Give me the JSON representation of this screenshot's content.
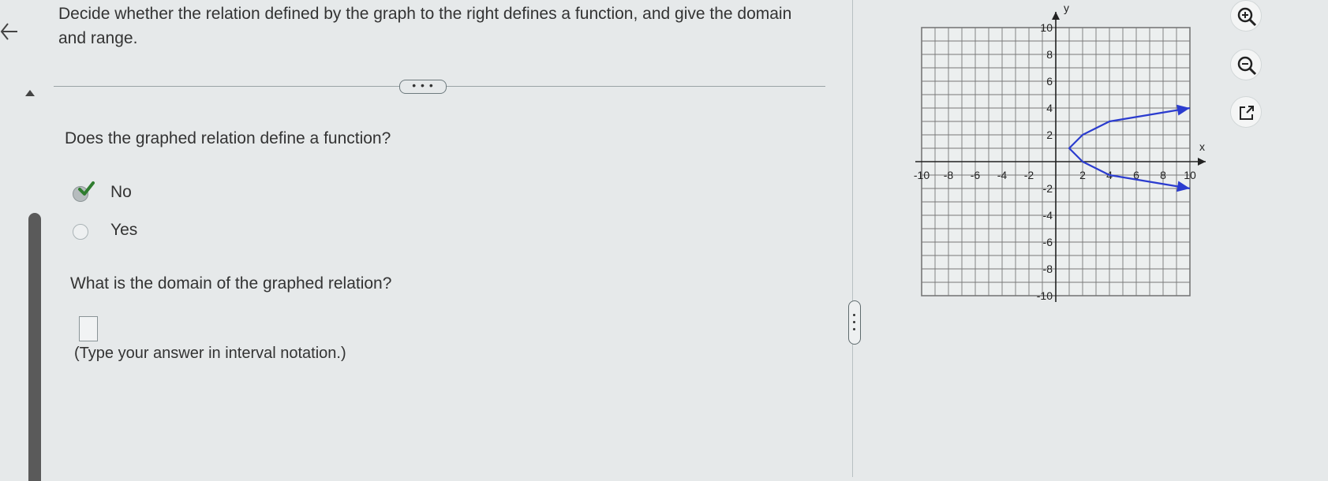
{
  "question": {
    "text": "Decide whether the relation defined by the graph to the right defines a function, and give the domain and range."
  },
  "more_button_label": "• • •",
  "part1": {
    "question": "Does the graphed relation define a function?",
    "options": [
      {
        "label": "No",
        "selected": true
      },
      {
        "label": "Yes",
        "selected": false
      }
    ]
  },
  "part2": {
    "question": "What is the domain of the graphed relation?",
    "answer_value": "",
    "hint": "(Type your answer in interval notation.)"
  },
  "graph": {
    "x_label": "x",
    "y_label": "y",
    "x_ticks": [
      "-10",
      "-8",
      "-6",
      "-4",
      "-2",
      "2",
      "4",
      "6",
      "8",
      "10"
    ],
    "y_ticks": [
      "10",
      "8",
      "6",
      "4",
      "2",
      "-2",
      "-4",
      "-6",
      "-8",
      "-10"
    ]
  },
  "chart_data": {
    "type": "line",
    "title": "",
    "xlabel": "x",
    "ylabel": "y",
    "xlim": [
      -10,
      10
    ],
    "ylim": [
      -10,
      10
    ],
    "grid": true,
    "series": [
      {
        "x": [
          10,
          7,
          4,
          2,
          1,
          2,
          4,
          7,
          10
        ],
        "y": [
          4,
          3.5,
          3,
          2,
          1,
          0,
          -1,
          -1.5,
          -2
        ],
        "color": "#2b3ccf",
        "arrows": "both-ends"
      }
    ]
  },
  "colors": {
    "accent_check": "#2f7d2f",
    "curve": "#2b3ccf"
  },
  "tools": [
    {
      "icon": "zoom-in-icon"
    },
    {
      "icon": "zoom-out-icon"
    },
    {
      "icon": "popout-icon"
    }
  ]
}
